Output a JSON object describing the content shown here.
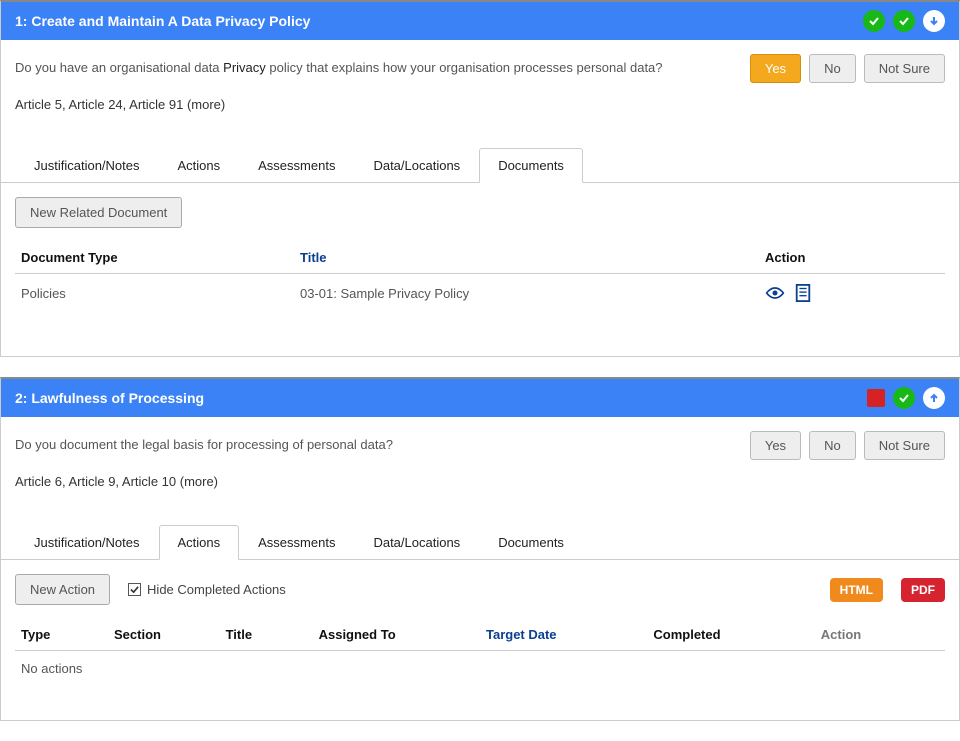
{
  "panel1": {
    "title": "1: Create and Maintain A Data Privacy Policy",
    "question_pre": "Do you have an organisational data ",
    "question_hl": "Privacy",
    "question_post": " policy that explains how your organisation processes personal data?",
    "articles": "Article 5, Article 24, Article 91 (more)",
    "answers": {
      "yes": "Yes",
      "no": "No",
      "notsure": "Not Sure"
    },
    "tabs": {
      "just": "Justification/Notes",
      "actions": "Actions",
      "assess": "Assessments",
      "dataloc": "Data/Locations",
      "docs": "Documents"
    },
    "newRelated": "New Related Document",
    "cols": {
      "type": "Document Type",
      "title": "Title",
      "action": "Action"
    },
    "row": {
      "type": "Policies",
      "title": "03-01: Sample Privacy Policy"
    }
  },
  "panel2": {
    "title": "2: Lawfulness of Processing",
    "question": "Do you document the legal basis for processing of personal data?",
    "articles": "Article 6, Article 9, Article 10 (more)",
    "answers": {
      "yes": "Yes",
      "no": "No",
      "notsure": "Not Sure"
    },
    "tabs": {
      "just": "Justification/Notes",
      "actions": "Actions",
      "assess": "Assessments",
      "dataloc": "Data/Locations",
      "docs": "Documents"
    },
    "newAction": "New Action",
    "hideCompleted": "Hide Completed Actions",
    "pills": {
      "html": "HTML",
      "pdf": "PDF"
    },
    "cols": {
      "type": "Type",
      "section": "Section",
      "title": "Title",
      "assigned": "Assigned To",
      "target": "Target Date",
      "completed": "Completed",
      "action": "Action"
    },
    "empty": "No actions"
  }
}
